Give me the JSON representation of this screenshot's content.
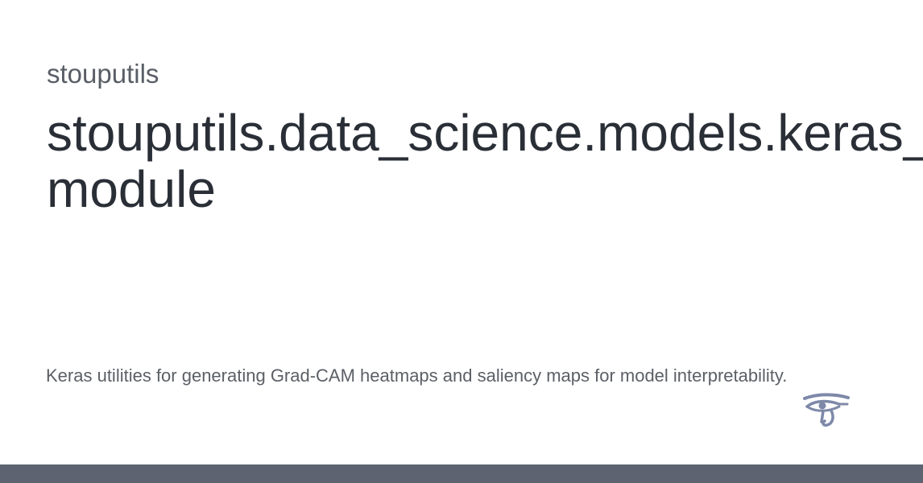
{
  "header": {
    "project": "stouputils",
    "title_line1": "stouputils.data_science.models.keras_",
    "title_line2": "module"
  },
  "main": {
    "description": "Keras utilities for generating Grad-CAM heatmaps and saliency maps for model interpretability."
  },
  "logo": {
    "icon": "eye-of-horus-icon",
    "color": "#7e89a8"
  },
  "footer": {
    "color": "#5d6370"
  }
}
